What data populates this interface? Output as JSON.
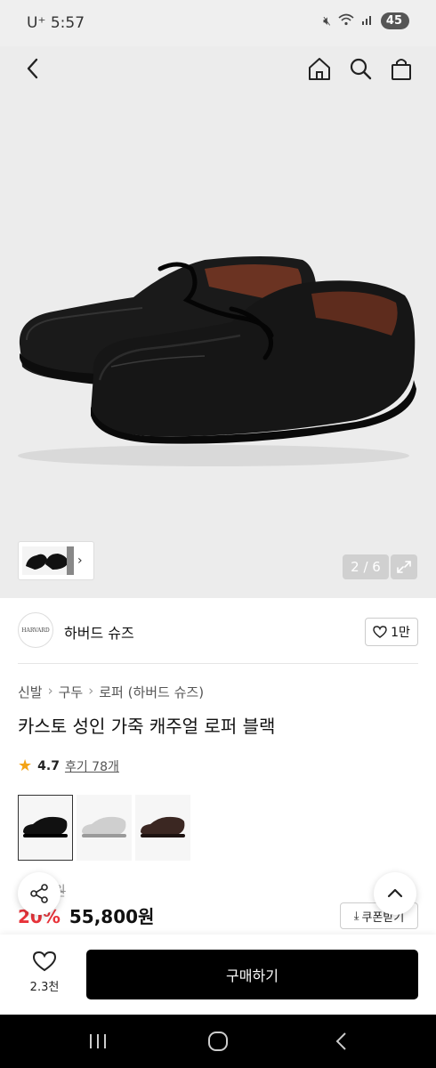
{
  "status_bar": {
    "carrier": "U⁺",
    "time": "5:57",
    "battery": "45"
  },
  "gallery": {
    "counter": "2 / 6"
  },
  "brand": {
    "logo_text": "HARVARD",
    "name": "하버드 슈즈",
    "like_count": "1만"
  },
  "breadcrumb": [
    "신발",
    "구두",
    "로퍼 (하버드 슈즈)"
  ],
  "product": {
    "title": "카스토 성인 가죽 캐주얼 로퍼 블랙",
    "rating": "4.7",
    "review_label": "후기 78개",
    "original_price": "원",
    "discount_rate": "20%",
    "sale_price": "55,800원",
    "coupon_label": "쿠폰받기"
  },
  "color_options": [
    "black",
    "white",
    "brown"
  ],
  "bottom_bar": {
    "wish_count": "2.3천",
    "buy_label": "구매하기"
  },
  "colors": {
    "accent_red": "#e8333a",
    "star": "#f3a316",
    "buy_button": "#000000"
  }
}
